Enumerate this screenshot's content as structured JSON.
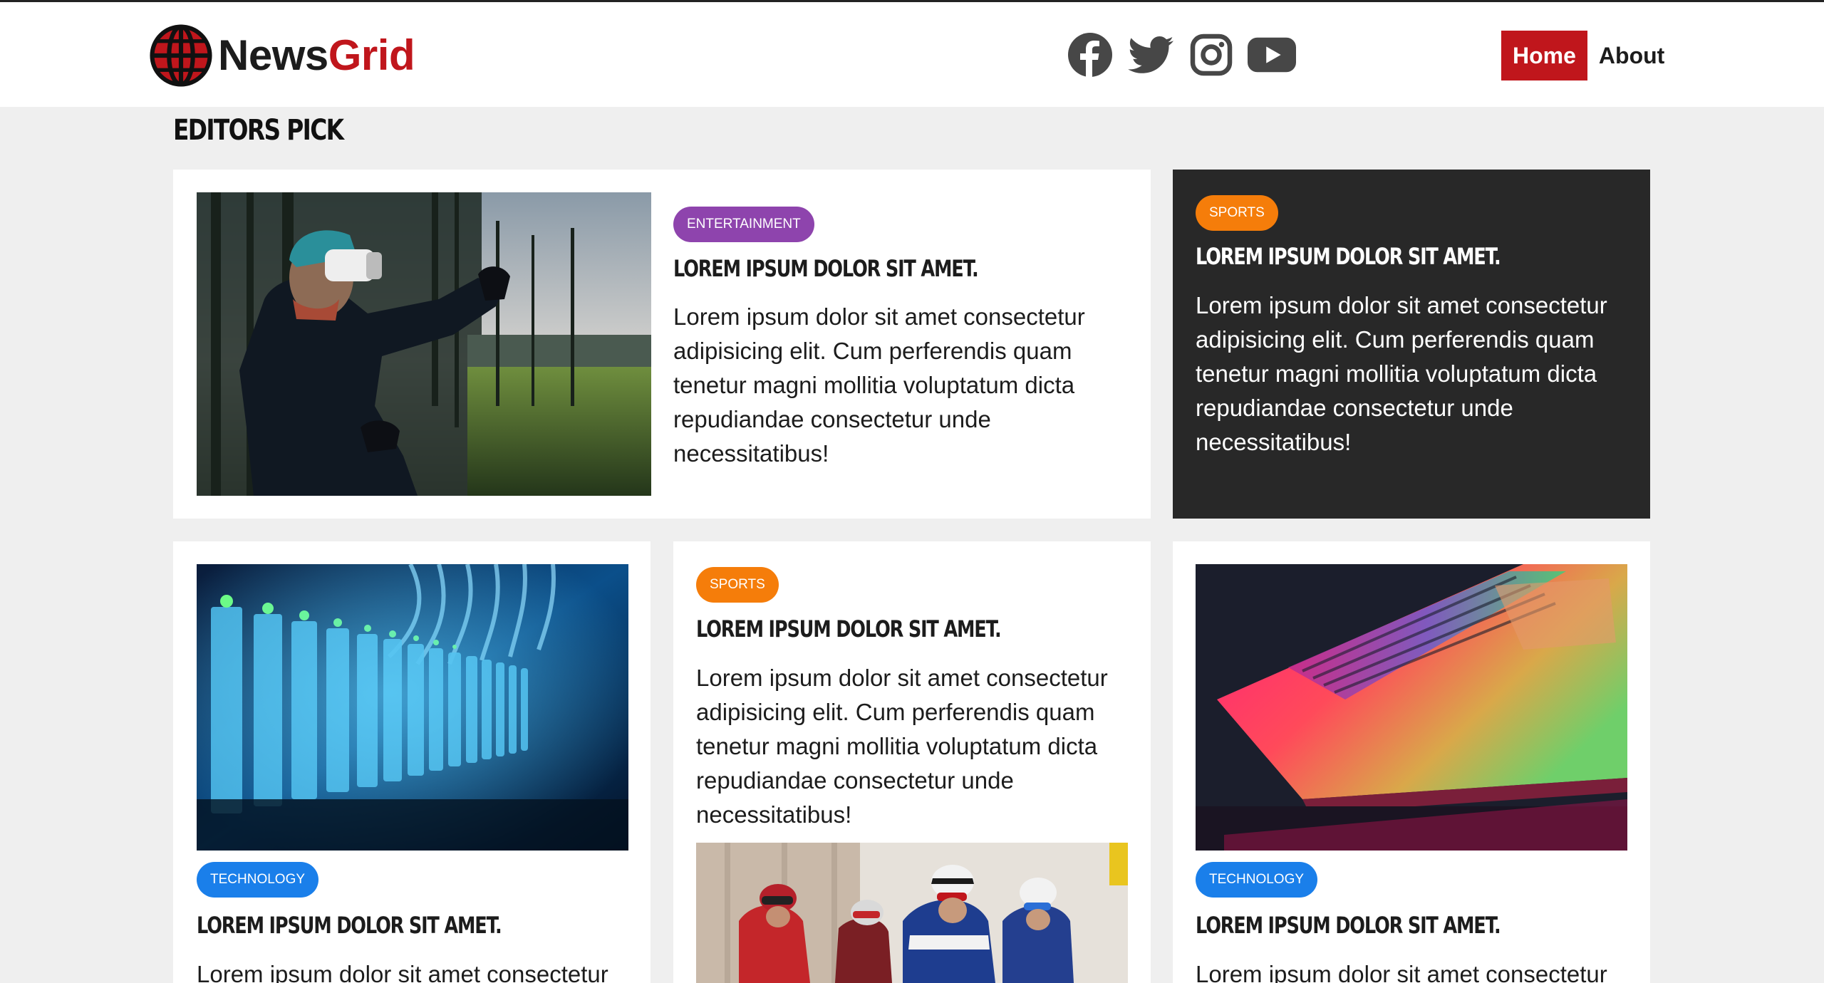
{
  "brand": {
    "name_part1": "News",
    "name_part2": "Grid",
    "accent_color": "#c0161c"
  },
  "social": [
    {
      "icon": "facebook-icon"
    },
    {
      "icon": "twitter-icon"
    },
    {
      "icon": "instagram-icon"
    },
    {
      "icon": "youtube-icon"
    }
  ],
  "nav": {
    "home": "Home",
    "about": "About"
  },
  "section": {
    "title": "Editors Pick"
  },
  "colors": {
    "entertainment": "#8e44ad",
    "sports": "#f57d0a",
    "technology": "#1a7fea",
    "dark_card": "#282828"
  },
  "cards": [
    {
      "category": "Entertainment",
      "title": "Lorem ipsum dolor sit amet.",
      "excerpt": "Lorem ipsum dolor sit amet consectetur adipisicing elit. Cum perferendis quam tenetur magni mollitia voluptatum dicta repudiandae consectetur unde necessitatibus!",
      "image": "vr-headset-man-in-forest"
    },
    {
      "category": "Sports",
      "title": "Lorem ipsum dolor sit amet.",
      "excerpt": "Lorem ipsum dolor sit amet consectetur adipisicing elit. Cum perferendis quam tenetur magni mollitia voluptatum dicta repudiandae consectetur unde necessitatibus!"
    },
    {
      "category": "Technology",
      "title": "Lorem ipsum dolor sit amet.",
      "excerpt": "Lorem ipsum dolor sit amet consectetur",
      "image": "server-rack-cables"
    },
    {
      "category": "Sports",
      "title": "Lorem ipsum dolor sit amet.",
      "excerpt": "Lorem ipsum dolor sit amet consectetur adipisicing elit. Cum perferendis quam tenetur magni mollitia voluptatum dicta repudiandae consectetur unde necessitatibus!",
      "image": "cyclists-racing"
    },
    {
      "category": "Technology",
      "title": "Lorem ipsum dolor sit amet.",
      "excerpt": "Lorem ipsum dolor sit amet consectetur",
      "image": "laptop-keyboard-rgb-light"
    }
  ]
}
